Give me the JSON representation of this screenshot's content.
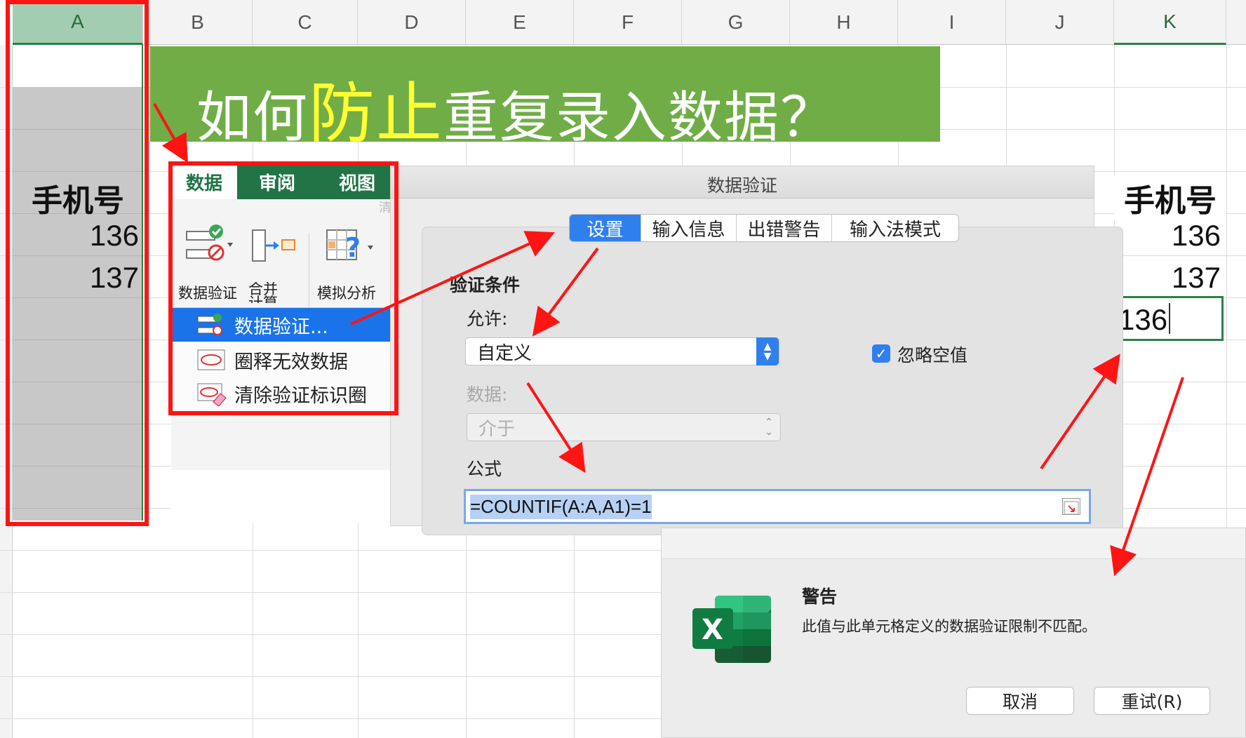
{
  "sheet": {
    "columns": [
      "A",
      "B",
      "C",
      "D",
      "E",
      "F",
      "G",
      "H",
      "I",
      "J",
      "K"
    ],
    "col_a_header_cell": "手机号",
    "col_a_values": [
      "136",
      "137"
    ],
    "col_k_header_cell": "手机号",
    "col_k_values": [
      "136",
      "137"
    ],
    "col_k_input": "136"
  },
  "banner": {
    "prefix": "如何",
    "highlight": "防止",
    "suffix": "重复录入数据？",
    "bg_color": "#70ad47",
    "highlight_color": "#ffff33"
  },
  "ribbon": {
    "tabs": [
      "数据",
      "审阅",
      "视图"
    ],
    "active_tab": "数据",
    "faded_label": "清",
    "buttons": [
      {
        "label": "数据验证",
        "icon": "data-validation-icon"
      },
      {
        "label": "合并计算",
        "icon": "consolidate-icon"
      },
      {
        "label": "模拟分析",
        "icon": "what-if-analysis-icon"
      }
    ],
    "menu": [
      {
        "label": "数据验证...",
        "icon": "data-validation-icon",
        "selected": true
      },
      {
        "label": "圈释无效数据",
        "icon": "circle-invalid-icon",
        "selected": false
      },
      {
        "label": "清除验证标识圈",
        "icon": "clear-circles-icon",
        "selected": false
      }
    ],
    "accent": "#227447"
  },
  "validation_dialog": {
    "title": "数据验证",
    "tabs": [
      "设置",
      "输入信息",
      "出错警告",
      "输入法模式"
    ],
    "active_tab": "设置",
    "section": "验证条件",
    "allow_label": "允许:",
    "allow_value": "自定义",
    "ignore_blank_label": "忽略空值",
    "ignore_blank_checked": true,
    "data_label": "数据:",
    "data_value": "介于",
    "formula_label": "公式",
    "formula_value": "=COUNTIF(A:A,A1)=1"
  },
  "warning_dialog": {
    "title": "警告",
    "message": "此值与此单元格定义的数据验证限制不匹配。",
    "cancel_label": "取消",
    "retry_label": "重试(R)",
    "app_icon": "excel-icon",
    "app_icon_letter": "X"
  },
  "annotation_color": "#ff1414"
}
